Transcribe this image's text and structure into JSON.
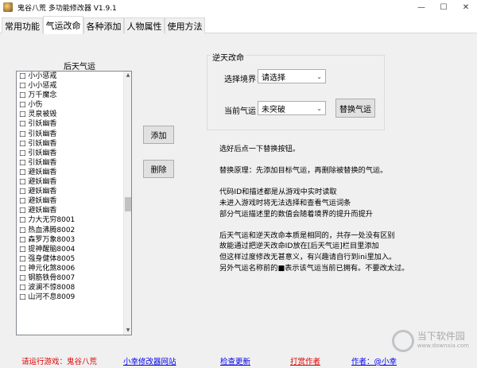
{
  "window": {
    "title": "鬼谷八荒 多功能修改器 V1.9.1",
    "buttons": [
      "—",
      "☐",
      "✕"
    ]
  },
  "tabs": [
    {
      "label": "常用功能"
    },
    {
      "label": "气运改命",
      "active": true
    },
    {
      "label": "各种添加"
    },
    {
      "label": "人物属性"
    },
    {
      "label": "使用方法"
    }
  ],
  "left": {
    "title": "后天气运",
    "items": [
      "□ 小小惩戒",
      "□ 小小惩戒",
      "□ 万千魔念",
      "□ 小伤",
      "□ 灵泉被毁",
      "□ 引妖幽香",
      "□ 引妖幽香",
      "□ 引妖幽香",
      "□ 引妖幽香",
      "□ 引妖幽香",
      "□ 避妖幽香",
      "□ 避妖幽香",
      "□ 避妖幽香",
      "□ 避妖幽香",
      "□ 避妖幽香",
      "□ 力大无穷8001",
      "□ 热血沸腾8002",
      "□ 森罗万象8003",
      "□ 提神醒脑8004",
      "□ 强身健体8005",
      "□ 神元化煞8006",
      "□ 钢筋铁骨8007",
      "□ 波澜不惊8008",
      "□ 山河不息8009"
    ],
    "add_button": "添加",
    "delete_button": "删除"
  },
  "right": {
    "group_title": "逆天改命",
    "realm_label": "选择境界：",
    "realm_value": "请选择",
    "fortune_label": "当前气运",
    "fortune_value": "未突破",
    "replace_button": "替换气运",
    "info_lines": [
      "选好后点一下替换按钮。",
      "",
      "替换原理：先添加目标气运，再删除被替换的气运。",
      "",
      "代码ID和描述都是从游戏中实时读取",
      "未进入游戏时将无法选择和查看气运词条",
      "部分气运描述里的数值会随着境界的提升而提升",
      "",
      "后天气运和逆天改命本质是相同的，共存一处没有区别",
      "故能通过把逆天改命ID放在[后天气运]栏目里添加",
      "但这样过度修改无甚意义，有兴趣请自行到ini里加入。",
      "另外气运名称前的■表示该气运当前已拥有。不要改太过。"
    ]
  },
  "footer": {
    "run_game": "请运行游戏：鬼谷八荒",
    "site_link": "小幸修改器网站",
    "check_update": "检查更新",
    "donate": "打赏作者",
    "author": "作者：@小幸"
  },
  "watermark": {
    "name": "当下软件园",
    "sub": "www.downxia.com"
  },
  "colors": {
    "link": "#0000ee",
    "red": "#e00000",
    "panel": "#f0f0f0"
  }
}
